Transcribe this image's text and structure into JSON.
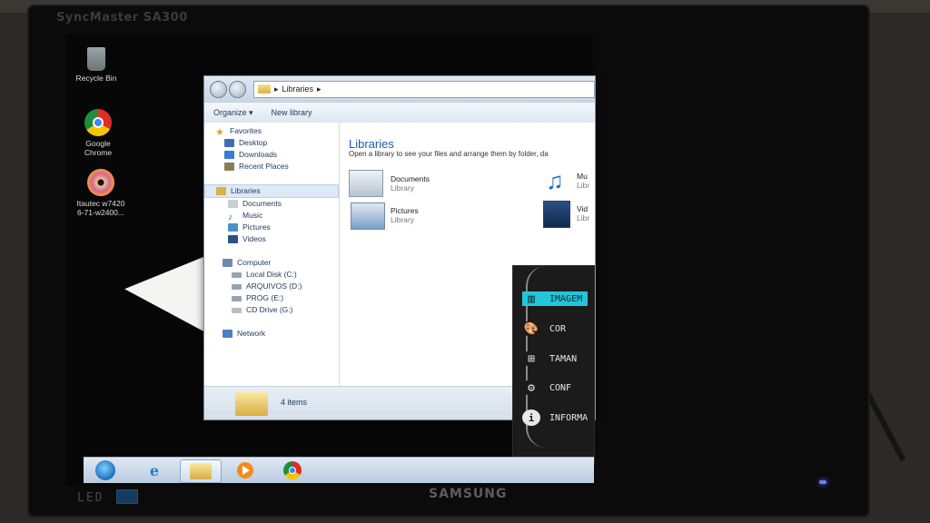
{
  "monitor": {
    "model_text": "SyncMaster SA300",
    "brand": "SAMSUNG",
    "led_text": "LED"
  },
  "desktop": {
    "icons": [
      {
        "label": "Recycle Bin"
      },
      {
        "label_line1": "Google",
        "label_line2": "Chrome"
      },
      {
        "label_line1": "Itautec w7420",
        "label_line2": "6-71-w2400..."
      }
    ]
  },
  "explorer": {
    "breadcrumb": "Libraries",
    "toolbar": {
      "organize": "Organize ▾",
      "new_library": "New library"
    },
    "nav": {
      "favorites": "Favorites",
      "desktop": "Desktop",
      "downloads": "Downloads",
      "recent": "Recent Places",
      "libraries": "Libraries",
      "documents": "Documents",
      "music": "Music",
      "pictures": "Pictures",
      "videos": "Videos",
      "computer": "Computer",
      "local_disk": "Local Disk (C:)",
      "arquivos": "ARQUIVOS (D:)",
      "prog": "PROG (E:)",
      "cd_drive": "CD Drive (G:)",
      "network": "Network"
    },
    "content": {
      "title": "Libraries",
      "subtitle": "Open a library to see your files and arrange them by folder, da",
      "items": [
        {
          "name": "Documents",
          "type": "Library"
        },
        {
          "name": "Pictures",
          "type": "Library"
        },
        {
          "name": "Mu",
          "type": "Libr"
        },
        {
          "name": "Vid",
          "type": "Libr"
        }
      ]
    },
    "status": {
      "count": "4 items"
    }
  },
  "osd_menu": {
    "items": [
      {
        "label": "IMAGEM"
      },
      {
        "label": "COR"
      },
      {
        "label": "TAMAN"
      },
      {
        "label": "CONF"
      },
      {
        "label": "INFORMA"
      }
    ],
    "accent": "#23c6d8"
  }
}
